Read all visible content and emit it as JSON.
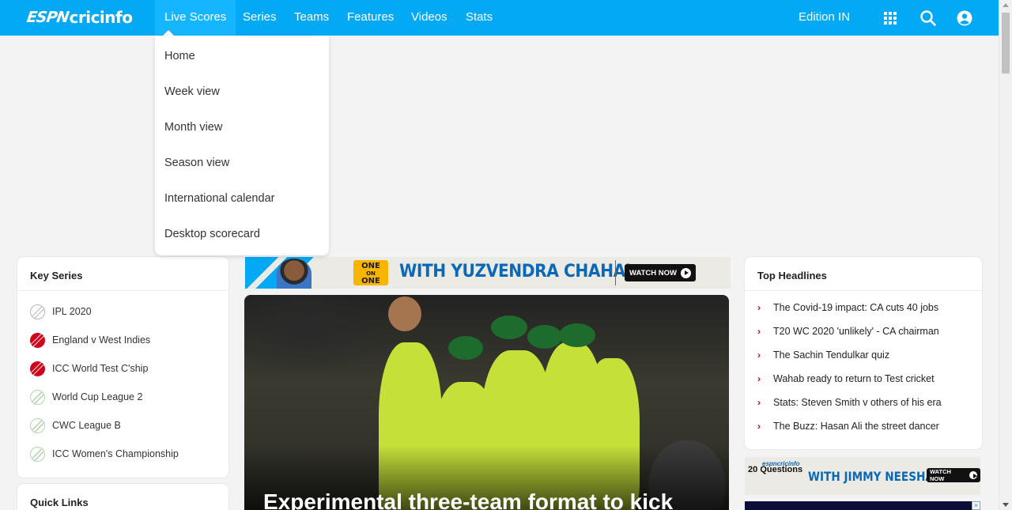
{
  "brand": {
    "espn": "ESPN",
    "cricinfo": "cricinfo"
  },
  "nav": {
    "items": [
      {
        "label": "Live Scores"
      },
      {
        "label": "Series"
      },
      {
        "label": "Teams"
      },
      {
        "label": "Features"
      },
      {
        "label": "Videos"
      },
      {
        "label": "Stats"
      }
    ],
    "active": "Live Scores",
    "edition": "Edition IN",
    "icons": [
      "apps-grid-icon",
      "search-icon",
      "user-icon"
    ]
  },
  "dropdown": {
    "items": [
      "Home",
      "Week view",
      "Month view",
      "Season view",
      "International calendar",
      "Desktop scorecard"
    ]
  },
  "key_series": {
    "title": "Key Series",
    "items": [
      {
        "label": "IPL 2020",
        "icon": "grey-ball"
      },
      {
        "label": "England v West Indies",
        "icon": "red-ball"
      },
      {
        "label": "ICC World Test C'ship",
        "icon": "red-ball"
      },
      {
        "label": "World Cup League 2",
        "icon": "white-ball"
      },
      {
        "label": "CWC League B",
        "icon": "white-ball"
      },
      {
        "label": "ICC Women's Championship",
        "icon": "white-ball"
      }
    ]
  },
  "quick_links": {
    "title": "Quick Links"
  },
  "banner": {
    "badge_line1": "ONE",
    "badge_line2": "ON",
    "badge_line3": "ONE",
    "headline": "WITH YUZVENDRA CHAHAL",
    "cta": "WATCH NOW"
  },
  "hero": {
    "title": "Experimental three-team format to kick"
  },
  "top_headlines": {
    "title": "Top Headlines",
    "items": [
      "The Covid-19 impact: CA cuts 40 jobs",
      "T20 WC 2020 'unlikely' - CA chairman",
      "The Sachin Tendulkar quiz",
      "Wahab ready to return to Test cricket",
      "Stats: Steven Smith v others of his era",
      "The Buzz: Hasan Ali the street dancer"
    ]
  },
  "side_ad": {
    "brand": "espncricinfo",
    "prefix": "20",
    "questions": "Questions",
    "headline": "WITH JIMMY NEESHAM",
    "cta": "WATCH NOW"
  },
  "colors": {
    "brand_blue": "#03a9f4",
    "accent_red": "#d0021b",
    "banner_blue": "#0a68b8"
  }
}
